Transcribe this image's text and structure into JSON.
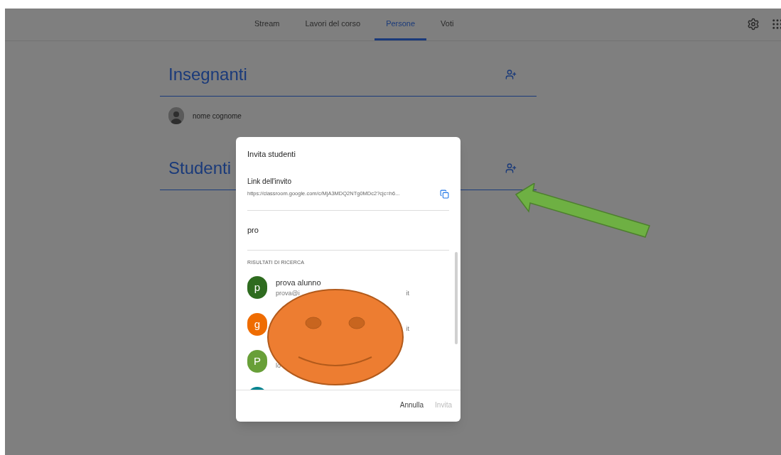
{
  "tabs": [
    {
      "label": "Stream",
      "selected": false
    },
    {
      "label": "Lavori del corso",
      "selected": false
    },
    {
      "label": "Persone",
      "selected": true
    },
    {
      "label": "Voti",
      "selected": false
    }
  ],
  "sections": [
    {
      "title": "Insegnanti",
      "people": [
        {
          "name": "nome cognome"
        }
      ]
    },
    {
      "title": "Studenti"
    }
  ],
  "dialog": {
    "title": "Invita studenti",
    "link_label": "Link dell'invito",
    "link": "https://classroom.google.com/c/MjA3MDQ2NTg0MDc2?cjc=h6...",
    "search_value": "pro",
    "results_heading": "RISULTATI DI RICERCA",
    "results": [
      {
        "letter": "p",
        "color": "#2e6b1f",
        "name": "prova alunno",
        "email_start": "prova@i",
        "email_end": "it"
      },
      {
        "letter": "g",
        "color": "#ef6c00",
        "email_end": "it"
      },
      {
        "letter": "P",
        "color": "#689f38",
        "email_start": "lo"
      },
      {
        "color": "#00838f"
      }
    ],
    "buttons": [
      {
        "label": "Annulla",
        "disabled": false
      },
      {
        "label": "Invita",
        "disabled": true
      }
    ]
  }
}
